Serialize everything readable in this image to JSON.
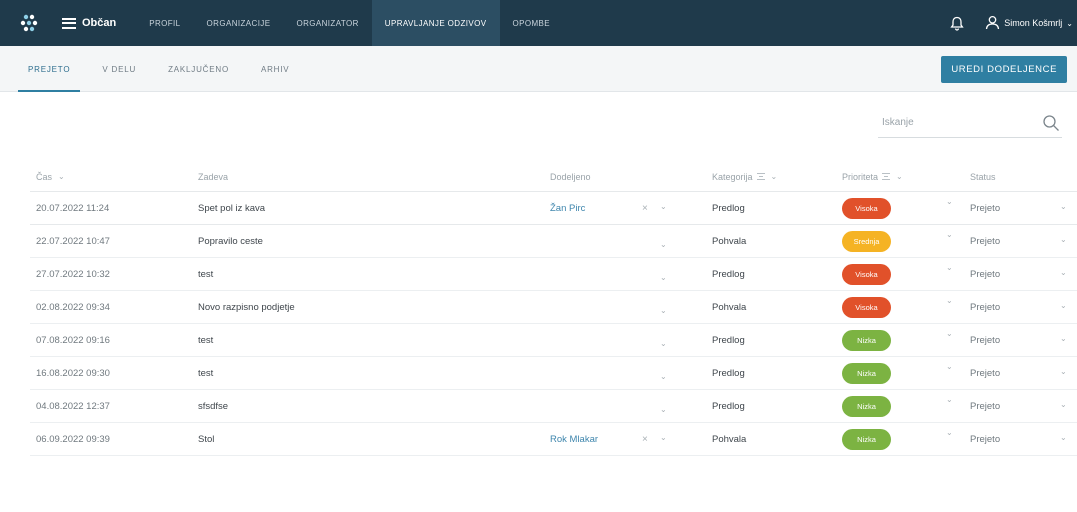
{
  "topbar": {
    "menu_label": "Občan",
    "nav": [
      {
        "label": "PROFIL",
        "active": false
      },
      {
        "label": "ORGANIZACIJE",
        "active": false
      },
      {
        "label": "ORGANIZATOR",
        "active": false
      },
      {
        "label": "UPRAVLJANJE ODZIVOV",
        "active": true
      },
      {
        "label": "OPOMBE",
        "active": false
      }
    ],
    "user_name": "Simon Košmrlj"
  },
  "tabs": [
    {
      "label": "PREJETO",
      "active": true
    },
    {
      "label": "V DELU",
      "active": false
    },
    {
      "label": "ZAKLJUČENO",
      "active": false
    },
    {
      "label": "ARHIV",
      "active": false
    }
  ],
  "primary_button": "UREDI DODELJENCE",
  "search": {
    "placeholder": "Iskanje"
  },
  "table": {
    "headers": {
      "cas": "Čas",
      "zadeva": "Zadeva",
      "dodeljeno": "Dodeljeno",
      "kategorija": "Kategorija",
      "prioriteta": "Prioriteta",
      "status": "Status"
    },
    "rows": [
      {
        "cas": "20.07.2022 11:24",
        "zadeva": "Spet pol iz kava",
        "dodeljeno": "Žan Pirc",
        "kategorija": "Predlog",
        "prioriteta": "Visoka",
        "status": "Prejeto"
      },
      {
        "cas": "22.07.2022 10:47",
        "zadeva": "Popravilo ceste",
        "dodeljeno": "",
        "kategorija": "Pohvala",
        "prioriteta": "Srednja",
        "status": "Prejeto"
      },
      {
        "cas": "27.07.2022 10:32",
        "zadeva": "test",
        "dodeljeno": "",
        "kategorija": "Predlog",
        "prioriteta": "Visoka",
        "status": "Prejeto"
      },
      {
        "cas": "02.08.2022 09:34",
        "zadeva": "Novo razpisno podjetje",
        "dodeljeno": "",
        "kategorija": "Pohvala",
        "prioriteta": "Visoka",
        "status": "Prejeto"
      },
      {
        "cas": "07.08.2022 09:16",
        "zadeva": "test",
        "dodeljeno": "",
        "kategorija": "Predlog",
        "prioriteta": "Nizka",
        "status": "Prejeto"
      },
      {
        "cas": "16.08.2022 09:30",
        "zadeva": "test",
        "dodeljeno": "",
        "kategorija": "Predlog",
        "prioriteta": "Nizka",
        "status": "Prejeto"
      },
      {
        "cas": "04.08.2022 12:37",
        "zadeva": "sfsdfse",
        "dodeljeno": "",
        "kategorija": "Predlog",
        "prioriteta": "Nizka",
        "status": "Prejeto"
      },
      {
        "cas": "06.09.2022 09:39",
        "zadeva": "Stol",
        "dodeljeno": "Rok Mlakar",
        "kategorija": "Pohvala",
        "prioriteta": "Nizka",
        "status": "Prejeto"
      }
    ]
  },
  "colors": {
    "topbar": "#1f3a4b",
    "accent": "#2f7fa2",
    "priority_high": "#e1512a",
    "priority_medium": "#f5b324",
    "priority_low": "#7cb342"
  },
  "icons": [
    "app-logo-icon",
    "hamburger-icon",
    "bell-icon",
    "user-icon",
    "search-icon",
    "filter-icon",
    "chevron-down-icon",
    "clear-icon"
  ]
}
